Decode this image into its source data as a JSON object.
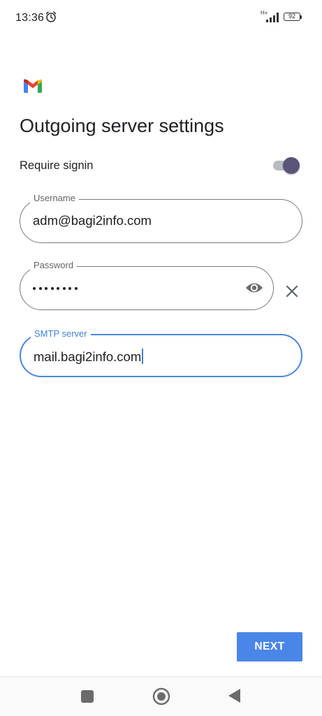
{
  "status_bar": {
    "time": "13:36",
    "alarm_icon": "alarm-clock-icon",
    "network_type": "H+",
    "signal_icon": "cellular-signal-icon",
    "battery_level": "92"
  },
  "header": {
    "logo_icon": "gmail-logo-icon",
    "title": "Outgoing server settings"
  },
  "form": {
    "require_signin": {
      "label": "Require signin",
      "enabled": true
    },
    "username": {
      "label": "Username",
      "value": "adm@bagi2info.com"
    },
    "password": {
      "label": "Password",
      "masked_length": 8,
      "visibility_icon": "eye-icon",
      "clear_icon": "close-icon"
    },
    "smtp_server": {
      "label": "SMTP server",
      "value": "mail.bagi2info.com",
      "focused": true
    }
  },
  "actions": {
    "next_label": "NEXT"
  },
  "nav_bar": {
    "recents_icon": "square-icon",
    "home_icon": "circle-icon",
    "back_icon": "triangle-back-icon"
  },
  "colors": {
    "accent": "#4a86e8",
    "focus_border": "#4a86d8",
    "toggle_thumb": "#5a5477",
    "text_primary": "#202124",
    "label_muted": "#5f6368"
  }
}
